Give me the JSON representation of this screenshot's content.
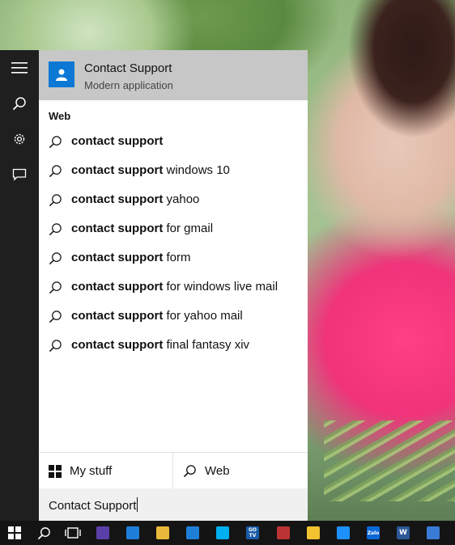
{
  "best_match": {
    "title": "Contact Support",
    "subtitle": "Modern application",
    "icon": "contact-support-person-icon",
    "icon_bg": "#0a78d4"
  },
  "web_section": {
    "heading": "Web"
  },
  "suggestions": [
    {
      "bold": "contact support",
      "rest": ""
    },
    {
      "bold": "contact support",
      "rest": " windows 10"
    },
    {
      "bold": "contact support",
      "rest": " yahoo"
    },
    {
      "bold": "contact support",
      "rest": " for gmail"
    },
    {
      "bold": "contact support",
      "rest": " form"
    },
    {
      "bold": "contact support",
      "rest": " for windows live mail"
    },
    {
      "bold": "contact support",
      "rest": " for yahoo mail"
    },
    {
      "bold": "contact support",
      "rest": " final fantasy xiv"
    }
  ],
  "tabs": {
    "my_stuff": "My stuff",
    "web": "Web"
  },
  "search": {
    "value": "Contact Support"
  },
  "rail": [
    "hamburger-menu-icon",
    "search-icon",
    "settings-gear-icon",
    "feedback-icon"
  ],
  "taskbar": {
    "pinned": [
      {
        "name": "task-view-icon"
      },
      {
        "name": "settings-app-icon",
        "color": "#5b3fa8"
      },
      {
        "name": "network-app-icon",
        "color": "#1e7fd8"
      },
      {
        "name": "file-explorer-icon",
        "color": "#e8b93a"
      },
      {
        "name": "store-icon",
        "color": "#1e7fd8"
      },
      {
        "name": "skype-icon",
        "color": "#00aff0"
      },
      {
        "name": "gotv-icon",
        "color": "#1a5ca8"
      },
      {
        "name": "media-app-icon",
        "color": "#b33"
      },
      {
        "name": "paint-app-icon",
        "color": "#f2c230"
      },
      {
        "name": "internet-explorer-icon",
        "color": "#1e90ff"
      },
      {
        "name": "zalo-icon",
        "color": "#0a68d8"
      },
      {
        "name": "word-icon",
        "color": "#2b5797"
      },
      {
        "name": "security-app-icon",
        "color": "#3a7bd5"
      }
    ],
    "labels": {
      "gotv": "GO TV",
      "word": "W",
      "zalo": "Zalo"
    }
  }
}
